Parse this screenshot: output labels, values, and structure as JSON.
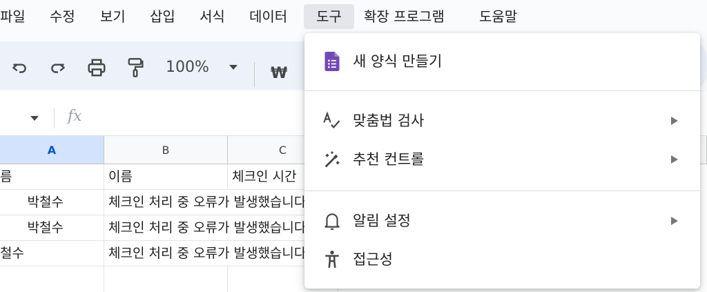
{
  "menubar": {
    "items": [
      {
        "label": "파일"
      },
      {
        "label": "수정"
      },
      {
        "label": "보기"
      },
      {
        "label": "삽입"
      },
      {
        "label": "서식"
      },
      {
        "label": "데이터"
      },
      {
        "label": "도구"
      },
      {
        "label": "확장 프로그램"
      },
      {
        "label": "도움말"
      }
    ],
    "active": "도구"
  },
  "toolbar": {
    "undo_icon": "undo-icon",
    "redo_icon": "redo-icon",
    "print_icon": "print-icon",
    "paint_format_icon": "paint-format-icon",
    "zoom": "100%",
    "currency": "₩"
  },
  "formula_bar": {
    "fx": "fx"
  },
  "grid": {
    "columns": [
      "A",
      "B",
      "C"
    ],
    "selected_column": "A",
    "rows": [
      [
        "름",
        "이름",
        "체크인 시간"
      ],
      [
        "박철수",
        "체크인 처리 중 오류가 발생했습니다",
        ""
      ],
      [
        "박철수",
        "체크인 처리 중 오류가 발생했습니다",
        ""
      ],
      [
        "철수",
        "체크인 처리 중 오류가 발생했습니다",
        ""
      ],
      [
        "",
        "",
        ""
      ]
    ]
  },
  "dropdown": {
    "items": [
      {
        "label": "새 양식 만들기",
        "icon": "forms-icon",
        "submenu": false
      },
      {
        "label": "맞춤법 검사",
        "icon": "spellcheck-icon",
        "submenu": true
      },
      {
        "label": "추천 컨트롤",
        "icon": "magic-wand-icon",
        "submenu": true
      },
      {
        "label": "알림 설정",
        "icon": "bell-icon",
        "submenu": true
      },
      {
        "label": "접근성",
        "icon": "accessibility-icon",
        "submenu": false
      }
    ]
  },
  "colors": {
    "accent": "#0b57d0",
    "forms_purple": "#7248b9",
    "selected_header": "#d3e3fd"
  }
}
